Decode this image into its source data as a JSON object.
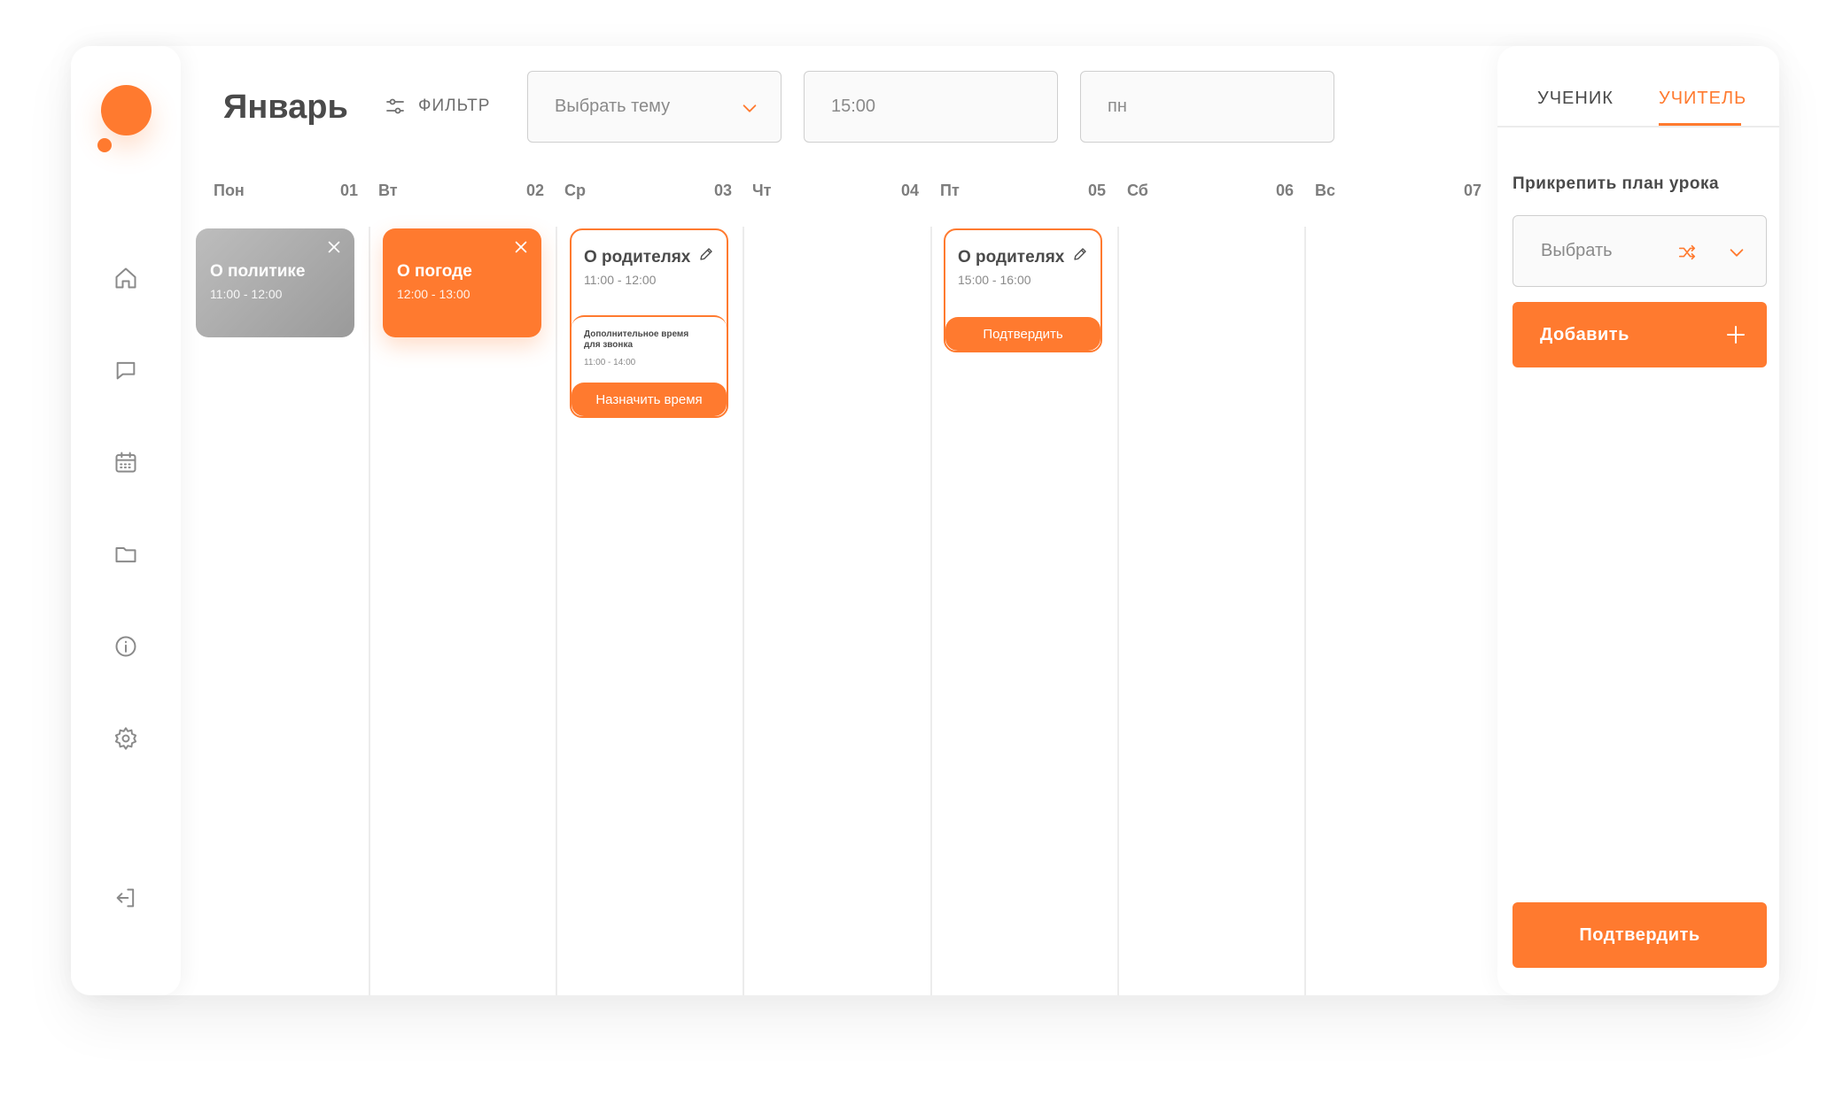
{
  "header": {
    "month": "Январь",
    "filter_label": "ФИЛЬТР",
    "topic_placeholder": "Выбрать тему",
    "time_value": "15:00",
    "day_value": "пн"
  },
  "days": [
    {
      "name": "Пон",
      "num": "01"
    },
    {
      "name": "Вт",
      "num": "02"
    },
    {
      "name": "Ср",
      "num": "03"
    },
    {
      "name": "Чт",
      "num": "04"
    },
    {
      "name": "Пт",
      "num": "05"
    },
    {
      "name": "Сб",
      "num": "06"
    },
    {
      "name": "Вс",
      "num": "07"
    }
  ],
  "events": {
    "politics": {
      "title": "О политике",
      "time": "11:00 - 12:00"
    },
    "weather": {
      "title": "О погоде",
      "time": "12:00 - 13:00"
    },
    "parents_wed": {
      "title": "О родителях",
      "time": "11:00 - 12:00",
      "extra_title": "Дополнительное время для звонка",
      "extra_time": "11:00 - 14:00",
      "button": "Назначить время"
    },
    "parents_fri": {
      "title": "О родителях",
      "time": "15:00 - 16:00",
      "button": "Подтвердить"
    }
  },
  "panel": {
    "tab_student": "УЧЕНИК",
    "tab_teacher": "УЧИТЕЛЬ",
    "attach_label": "Прикрепить план урока",
    "select_placeholder": "Выбрать",
    "add_button": "Добавить",
    "confirm_button": "Подтвердить"
  },
  "colors": {
    "accent": "#FF7A2F",
    "gray_card": "#A6A6A6",
    "text": "#4A4A4A"
  }
}
